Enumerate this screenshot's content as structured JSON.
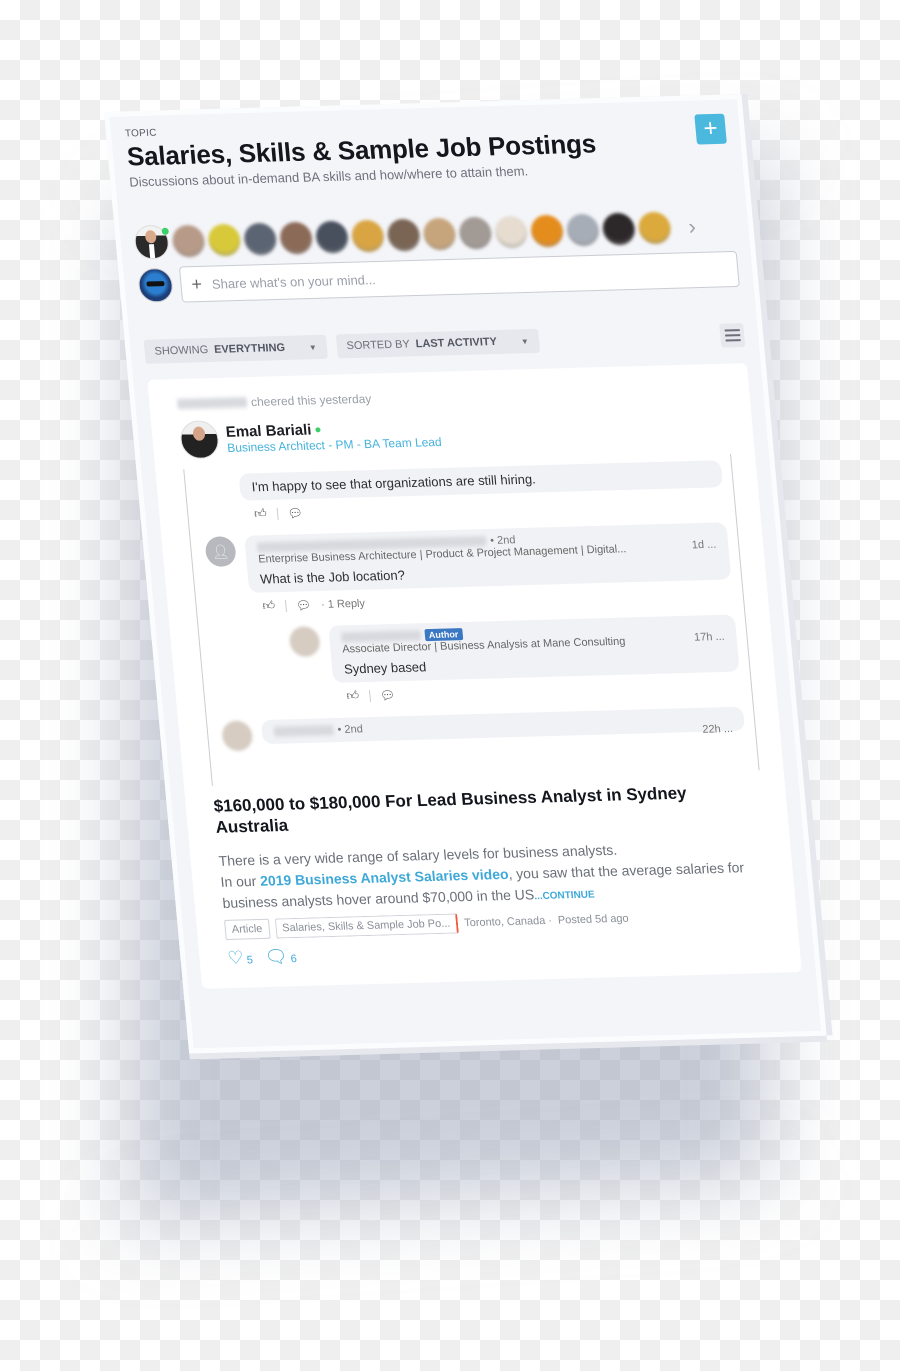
{
  "topic": {
    "label": "TOPIC",
    "title": "Salaries, Skills & Sample Job Postings",
    "subtitle": "Discussions about in-demand BA skills and how/where to attain them.",
    "add_button_icon": "plus-icon",
    "add_button_label": "+",
    "accent_color": "#4bb8de"
  },
  "members": {
    "avatar_colors": [
      "#b79a88",
      "#d8c93a",
      "#5b6472",
      "#8b6a58",
      "#48505e",
      "#d9a543",
      "#7a6454",
      "#c7a57c",
      "#a29a95",
      "#e6dcd0",
      "#e58d1c",
      "#a7adb6",
      "#2c2728",
      "#dcaa3c"
    ],
    "next_icon": "›"
  },
  "composer": {
    "placeholder": "Share what's on your mind...",
    "plus_icon": "+"
  },
  "filters": {
    "showing_prefix": "SHOWING",
    "showing_value": "EVERYTHING",
    "sorted_prefix": "SORTED BY",
    "sorted_value": "LAST ACTIVITY",
    "caret": "▼"
  },
  "post": {
    "cheer_text": "cheered this yesterday",
    "author_name": "Emal Bariali",
    "author_role": "Business Architect - PM - BA Team Lead",
    "comments": [
      {
        "text": "I'm happy to see that organizations are still hiring."
      },
      {
        "degree": "• 2nd",
        "headline": "Enterprise Business Architecture | Product & Project Management | Digital...",
        "time": "1d ...",
        "text": "What is the Job location?",
        "reply_count": "· 1 Reply"
      },
      {
        "badge": "Author",
        "headline": "Associate Director | Business Analysis at Mane Consulting",
        "time": "17h ...",
        "text": "Sydney based"
      },
      {
        "degree": "• 2nd",
        "time": "22h ..."
      }
    ],
    "article_title": "$160,000 to $180,000 For Lead Business Analyst in Sydney Australia",
    "excerpt_line1": "There is a very wide range of salary levels for business analysts.",
    "excerpt_prefix": "In our ",
    "excerpt_link": "2019 Business Analyst Salaries video",
    "excerpt_rest": ", you saw that the average salaries for business analysts hover around $70,000 in the US",
    "continue_label": "...CONTINUE",
    "tag_type": "Article",
    "tag_topic": "Salaries, Skills & Sample Job Po...",
    "location": "Toronto, Canada ·",
    "posted": "Posted 5d ago",
    "likes": "5",
    "comments_count": "6"
  }
}
